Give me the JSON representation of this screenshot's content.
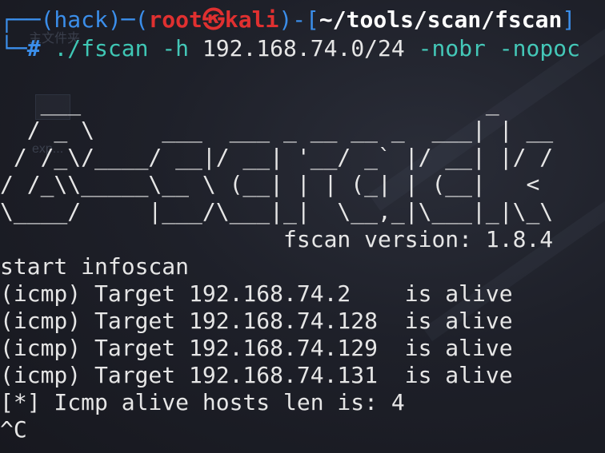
{
  "prompt": {
    "env": "(hack)",
    "user": "root",
    "sep_icon": "㉿",
    "host": "kali",
    "cwd": "~/tools/scan/fscan",
    "symbol": "#"
  },
  "command": {
    "exe": "./fscan",
    "flag1": "-h",
    "arg1": "192.168.74.0/24",
    "flag2": "-nobr",
    "flag3": "-nopoc"
  },
  "banner": {
    "line1": "   ___                              _    ",
    "line2": "  / _ \\     ___  ___ _ __ __ _  ___| | __ ",
    "line3": " / /_\\/____/ __|/ __| '__/ _` |/ __| |/ /",
    "line4": "/ /_\\\\_____\\__ \\ (__| | | (_| | (__|   <    ",
    "line5": "\\____/     |___/\\___|_|  \\__,_|\\___|_|\\_\\   ",
    "version": "                     fscan version: 1.8.4"
  },
  "output": [
    "start infoscan",
    "(icmp) Target 192.168.74.2    is alive",
    "(icmp) Target 192.168.74.128  is alive",
    "(icmp) Target 192.168.74.129  is alive",
    "(icmp) Target 192.168.74.131  is alive",
    "[*] Icmp alive hosts len is: 4",
    "^C"
  ],
  "background": {
    "ghost_label1": "主文件夹",
    "ghost_label2": "exp..."
  },
  "colors": {
    "prompt_blue": "#3b8eea",
    "root_red": "#e03030",
    "flag_teal": "#44c8b8",
    "background": "#1b1d26"
  }
}
